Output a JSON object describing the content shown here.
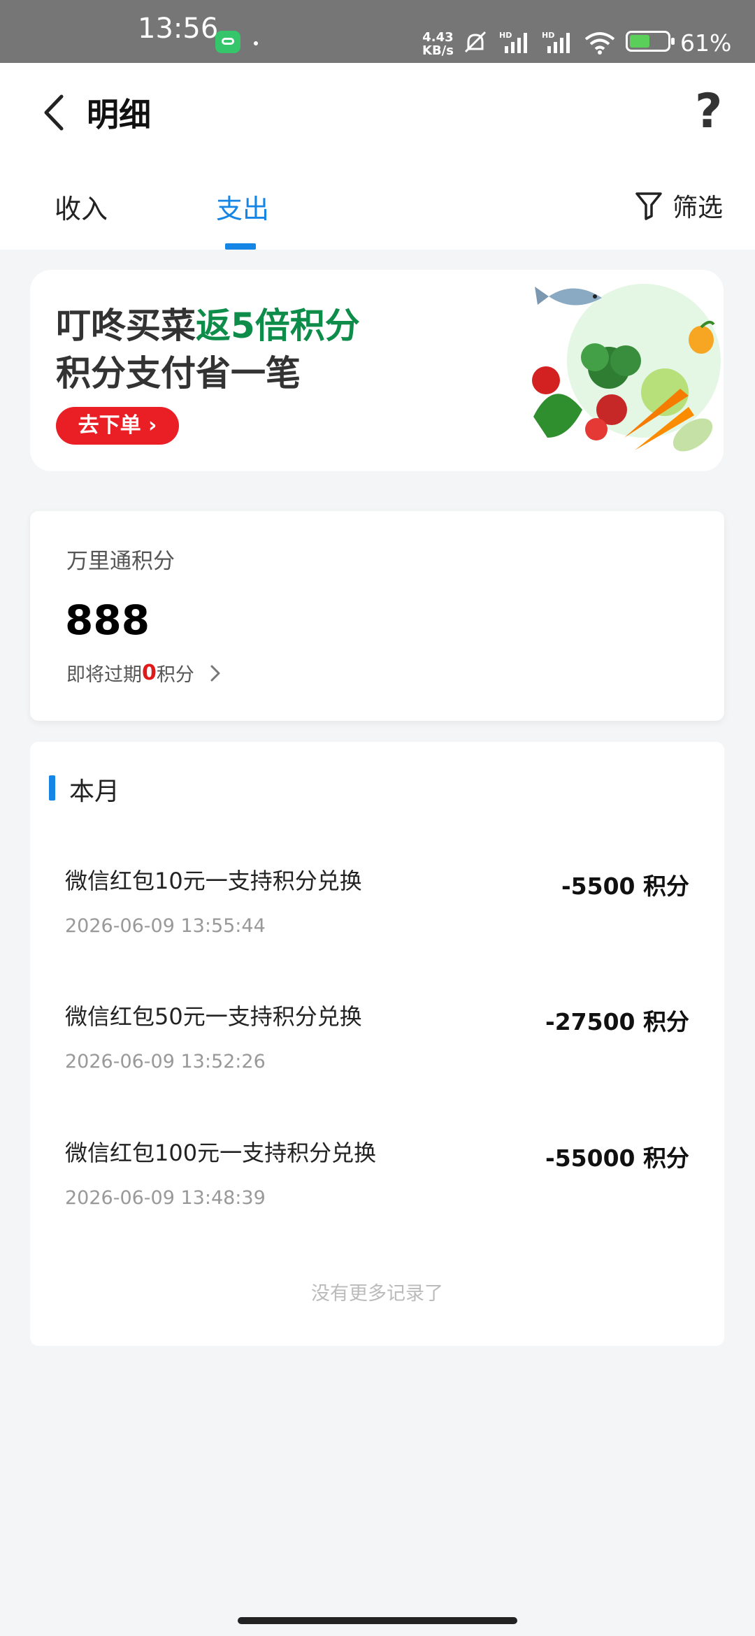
{
  "status_bar": {
    "time": "13:56",
    "net_speed_value": "4.43",
    "net_speed_unit": "KB/s",
    "battery": "61%"
  },
  "header": {
    "title": "明细",
    "help_icon": "?",
    "tabs": [
      {
        "label": "收入"
      },
      {
        "label": "支出"
      }
    ],
    "filter_label": "筛选"
  },
  "banner": {
    "line1_prefix": "叮咚买菜",
    "line1_highlight": "返5倍积分",
    "line2": "积分支付省一笔",
    "button_label": "去下单 ›"
  },
  "points": {
    "label": "万里通积分",
    "value": "888",
    "expire_prefix": "即将过期",
    "expire_count": "0",
    "expire_suffix": "积分"
  },
  "records": {
    "month_label": "本月",
    "items": [
      {
        "title": "微信红包10元一支持积分兑换",
        "amount": "-5500 积分",
        "time": "2026-06-09 13:55:44"
      },
      {
        "title": "微信红包50元一支持积分兑换",
        "amount": "-27500 积分",
        "time": "2026-06-09 13:52:26"
      },
      {
        "title": "微信红包100元一支持积分兑换",
        "amount": "-55000 积分",
        "time": "2026-06-09 13:48:39"
      }
    ],
    "no_more": "没有更多记录了"
  },
  "colors": {
    "accent_blue": "#1585e6",
    "highlight_green": "#0e8c4a",
    "button_red": "#ea1f25"
  }
}
